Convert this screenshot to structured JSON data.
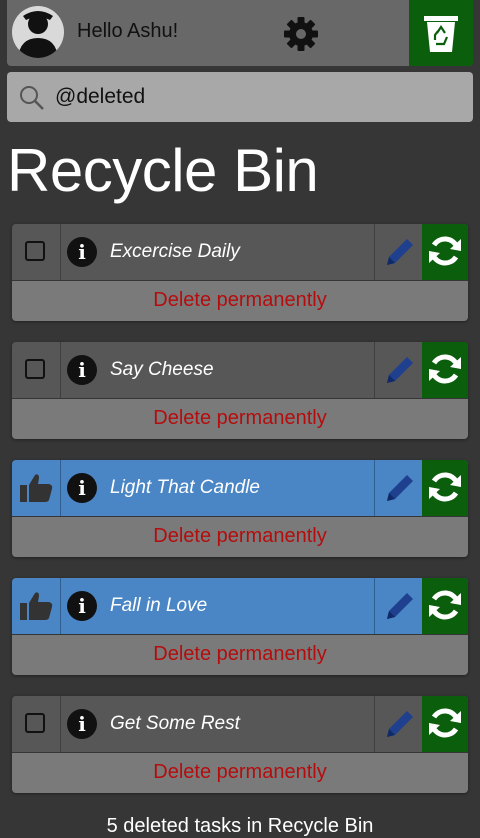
{
  "header": {
    "greeting": "Hello Ashu!",
    "avatar_icon": "user-avatar-icon",
    "settings_icon": "gear-icon",
    "recycle_icon": "recycle-bin-icon"
  },
  "search": {
    "value": "@deleted",
    "icon": "search-icon"
  },
  "page_title": "Recycle Bin",
  "colors": {
    "background": "#363636",
    "task_bg": "#575757",
    "task_done_bg": "#4a86c5",
    "delete_bar_bg": "#7a7a7a",
    "delete_text": "#b50d0d",
    "restore_bg": "#0b5e0b",
    "edit_icon": "#1f3f8f"
  },
  "tasks": [
    {
      "title": "Excercise Daily",
      "status": "unchecked",
      "delete_label": "Delete permanently"
    },
    {
      "title": "Say Cheese",
      "status": "unchecked",
      "delete_label": "Delete permanently"
    },
    {
      "title": "Light That Candle",
      "status": "done",
      "delete_label": "Delete permanently"
    },
    {
      "title": "Fall in Love",
      "status": "done",
      "delete_label": "Delete permanently"
    },
    {
      "title": "Get Some Rest",
      "status": "unchecked",
      "delete_label": "Delete permanently"
    }
  ],
  "footer": {
    "summary": "5 deleted tasks in Recycle Bin"
  }
}
